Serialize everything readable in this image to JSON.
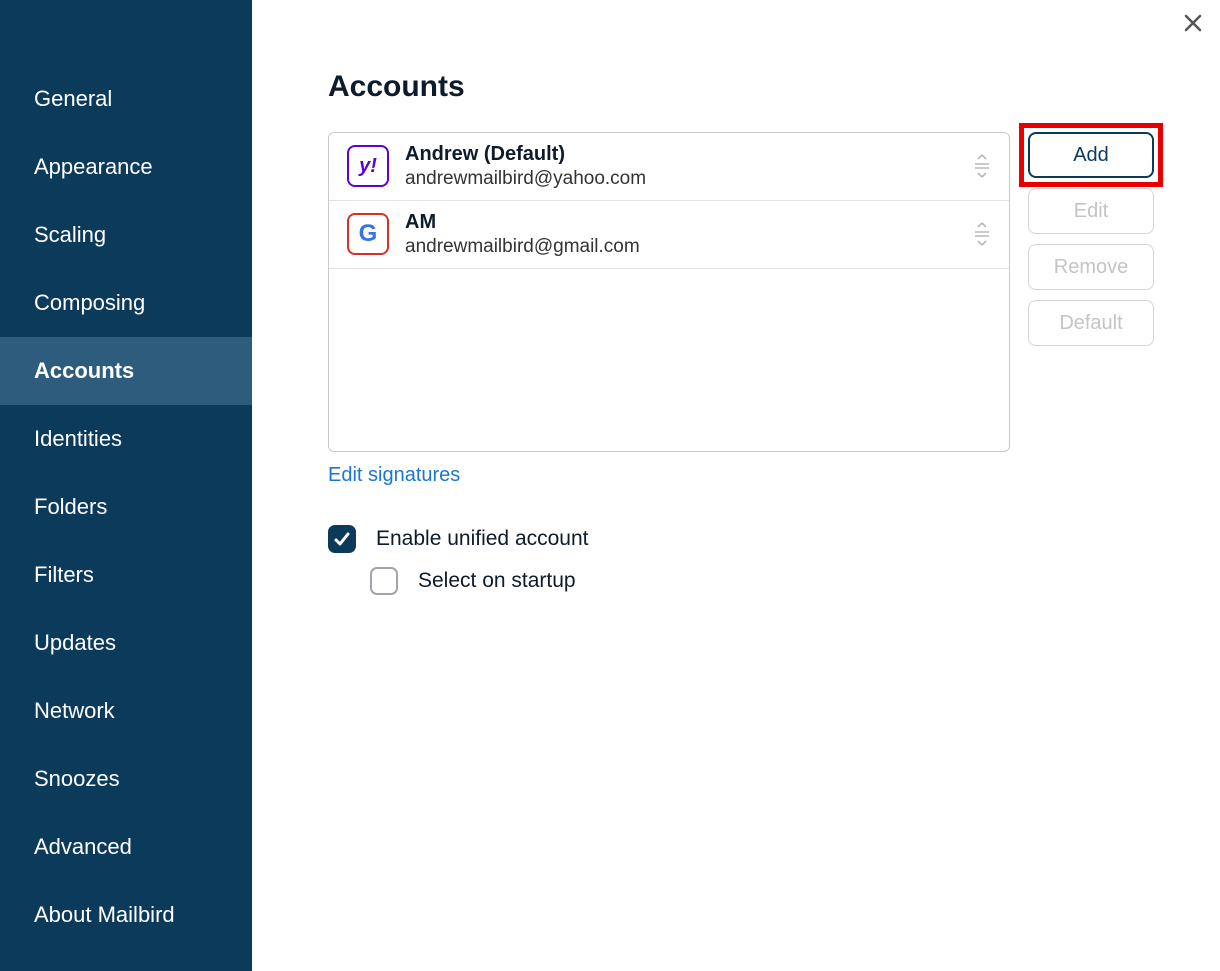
{
  "sidebar": {
    "items": [
      {
        "label": "General"
      },
      {
        "label": "Appearance"
      },
      {
        "label": "Scaling"
      },
      {
        "label": "Composing"
      },
      {
        "label": "Accounts",
        "active": true
      },
      {
        "label": "Identities"
      },
      {
        "label": "Folders"
      },
      {
        "label": "Filters"
      },
      {
        "label": "Updates"
      },
      {
        "label": "Network"
      },
      {
        "label": "Snoozes"
      },
      {
        "label": "Advanced"
      },
      {
        "label": "About Mailbird"
      }
    ]
  },
  "page": {
    "title": "Accounts"
  },
  "accounts": [
    {
      "name": "Andrew (Default)",
      "email": "andrewmailbird@yahoo.com",
      "provider": "yahoo",
      "icon_text": "y!"
    },
    {
      "name": "AM",
      "email": "andrewmailbird@gmail.com",
      "provider": "gmail",
      "icon_text": "G"
    }
  ],
  "buttons": {
    "add": "Add",
    "edit": "Edit",
    "remove": "Remove",
    "default": "Default"
  },
  "links": {
    "edit_signatures": "Edit signatures"
  },
  "options": {
    "enable_unified": "Enable unified account",
    "select_on_startup": "Select on startup"
  }
}
